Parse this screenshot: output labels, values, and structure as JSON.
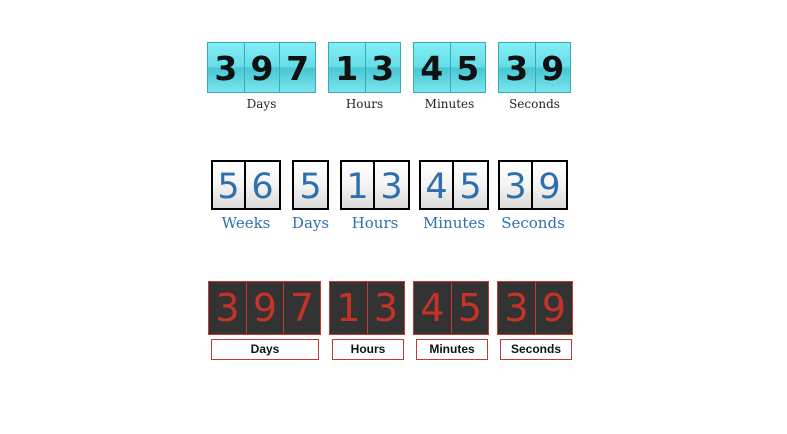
{
  "countdown_cyan": {
    "days": {
      "digits": [
        "3",
        "9",
        "7"
      ],
      "label": "Days"
    },
    "hours": {
      "digits": [
        "1",
        "3"
      ],
      "label": "Hours"
    },
    "minutes": {
      "digits": [
        "4",
        "5"
      ],
      "label": "Minutes"
    },
    "seconds": {
      "digits": [
        "3",
        "9"
      ],
      "label": "Seconds"
    }
  },
  "countdown_outlined": {
    "weeks": {
      "digits": [
        "5",
        "6"
      ],
      "label": "Weeks"
    },
    "days": {
      "digits": [
        "5"
      ],
      "label": "Days"
    },
    "hours": {
      "digits": [
        "1",
        "3"
      ],
      "label": "Hours"
    },
    "minutes": {
      "digits": [
        "4",
        "5"
      ],
      "label": "Minutes"
    },
    "seconds": {
      "digits": [
        "3",
        "9"
      ],
      "label": "Seconds"
    }
  },
  "countdown_dark": {
    "days": {
      "digits": [
        "3",
        "9",
        "7"
      ],
      "label": "Days"
    },
    "hours": {
      "digits": [
        "1",
        "3"
      ],
      "label": "Hours"
    },
    "minutes": {
      "digits": [
        "4",
        "5"
      ],
      "label": "Minutes"
    },
    "seconds": {
      "digits": [
        "3",
        "9"
      ],
      "label": "Seconds"
    }
  },
  "colors": {
    "cyan_digit_bg": "#66dde8",
    "outlined_digit_text": "#2f6fad",
    "dark_digit_bg": "#333333",
    "dark_digit_text": "#c43326",
    "dark_border": "#c23b2e"
  }
}
